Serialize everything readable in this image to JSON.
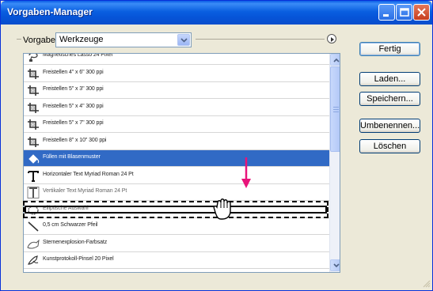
{
  "window": {
    "title": "Vorgaben-Manager"
  },
  "preset": {
    "label": "Vorgabe:",
    "value": "Werkzeuge"
  },
  "list": {
    "items": [
      {
        "label": "Magnetisches Lasso 24 Pixel",
        "icon": "magnetic-lasso-icon",
        "state": "normal"
      },
      {
        "label": "Freistellen 4\" x 6\" 300 ppi",
        "icon": "crop-icon",
        "state": "normal"
      },
      {
        "label": "Freistellen 5\" x 3\" 300 ppi",
        "icon": "crop-icon",
        "state": "normal"
      },
      {
        "label": "Freistellen 5\" x 4\" 300 ppi",
        "icon": "crop-icon",
        "state": "normal"
      },
      {
        "label": "Freistellen 5\" x 7\" 300 ppi",
        "icon": "crop-icon",
        "state": "normal"
      },
      {
        "label": "Freistellen 8\" x 10\" 300 ppi",
        "icon": "crop-icon",
        "state": "normal"
      },
      {
        "label": "Füllen mit Blasenmuster",
        "icon": "paint-bucket-icon",
        "state": "selected"
      },
      {
        "label": "Horizontaler Text Myriad Roman 24 Pt",
        "icon": "type-icon",
        "state": "normal"
      },
      {
        "label": "Vertikaler Text Myriad Roman 24 Pt",
        "icon": "vertical-type-icon",
        "state": "ghost"
      },
      {
        "label": "Elliptische Auswahl",
        "icon": "ellipse-icon",
        "state": "ghost"
      },
      {
        "label": "0,5 cm Schwarzer Pfeil",
        "icon": "line-icon",
        "state": "normal"
      },
      {
        "label": "Sternenexplosion-Farbsatz",
        "icon": "custom-shape-icon",
        "state": "normal"
      },
      {
        "label": "Kunstprotokoll-Pinsel 20 Pixel",
        "icon": "art-history-brush-icon",
        "state": "normal"
      }
    ]
  },
  "buttons": {
    "done": "Fertig",
    "load": "Laden...",
    "save": "Speichern...",
    "rename": "Umbenennen...",
    "delete": "Löschen"
  },
  "colors": {
    "selection": "#316ac5",
    "drag_arrow": "#e8147a",
    "titlebar": "#0a5ce6"
  }
}
